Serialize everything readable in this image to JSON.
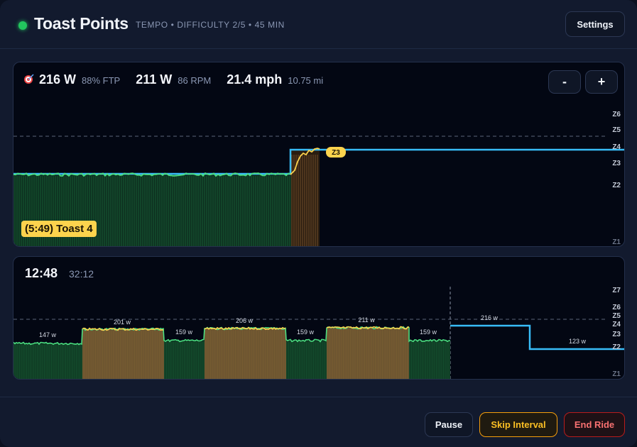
{
  "header": {
    "title": "Toast Points",
    "subtitle": "TEMPO • DIFFICULTY 2/5 • 45 MIN",
    "settings_label": "Settings",
    "status_color": "#22c55e"
  },
  "live_panel": {
    "target_power": "216 W",
    "target_ftp": "88% FTP",
    "power": "211 W",
    "cadence": "86 RPM",
    "speed": "21.4 mph",
    "distance": "10.75 mi",
    "zoom_out_label": "-",
    "zoom_in_label": "+",
    "interval_label": "(5:49) Toast 4",
    "current_zone_badge": "Z3",
    "zone_labels": [
      "Z6",
      "Z5",
      "Z4",
      "Z3",
      "Z2",
      "Z1"
    ]
  },
  "overview_panel": {
    "elapsed": "12:48",
    "remaining": "32:12",
    "zone_labels": [
      "Z7",
      "Z6",
      "Z5",
      "Z4",
      "Z3",
      "Z2",
      "Z1"
    ],
    "interval_labels": [
      "147 w",
      "201 w",
      "159 w",
      "206 w",
      "159 w",
      "211 w",
      "159 w",
      "216 w",
      "123 w"
    ]
  },
  "footer": {
    "pause_label": "Pause",
    "skip_label": "Skip Interval",
    "end_label": "End Ride"
  },
  "colors": {
    "target_line": "#38bdf8",
    "power_line_recovery": "#4ade80",
    "power_line_work": "#fcd34d",
    "recovery_fill": "#166534",
    "work_fill": "#8b6a2f",
    "badge": "#fcd34d"
  }
}
